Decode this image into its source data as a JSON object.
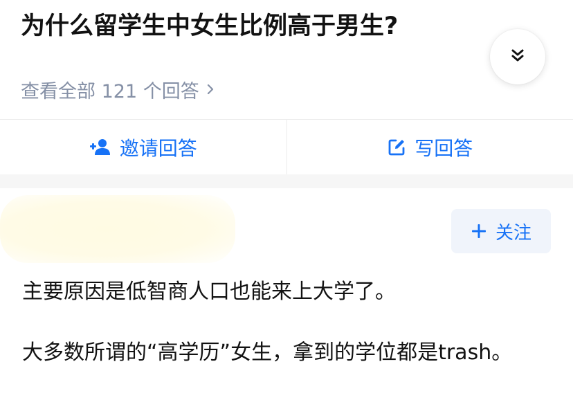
{
  "question": {
    "title": "为什么留学生中女生比例高于男生?",
    "view_all": "查看全部 121 个回答"
  },
  "actions": {
    "invite_label": "邀请回答",
    "write_label": "写回答"
  },
  "answer": {
    "follow_label": "关注",
    "paragraphs": [
      "主要原因是低智商人口也能来上大学了。",
      "大多数所谓的“高学历”女生，拿到的学位都是trash。"
    ]
  },
  "colors": {
    "accent": "#1772f6",
    "muted": "#8590a6",
    "text": "#121212"
  },
  "icons": [
    "chevrons-down-icon",
    "chevron-right-icon",
    "add-user-icon",
    "edit-icon",
    "plus-icon"
  ]
}
